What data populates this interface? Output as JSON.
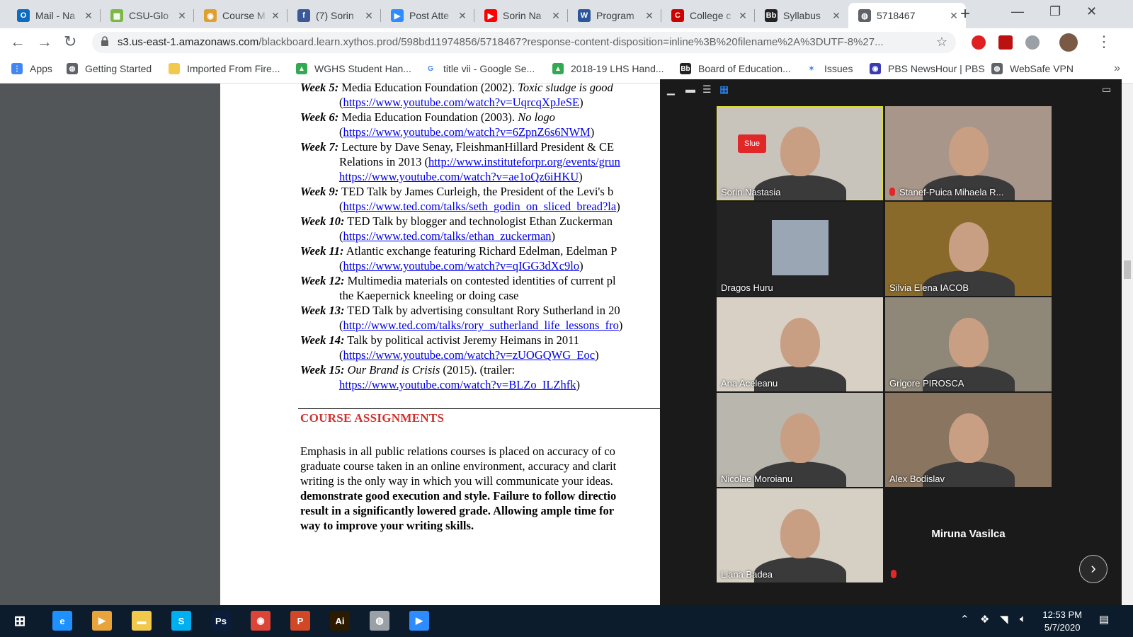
{
  "tabs": [
    {
      "title": "Mail - Na",
      "color": "#0f6cbd",
      "glyph": "O"
    },
    {
      "title": "CSU-Glo",
      "color": "#7db847",
      "glyph": "▦"
    },
    {
      "title": "Course M",
      "color": "#e0a030",
      "glyph": "◉"
    },
    {
      "title": "(7) Sorin",
      "color": "#3b5998",
      "glyph": "f"
    },
    {
      "title": "Post Atte",
      "color": "#2d8cff",
      "glyph": "▶"
    },
    {
      "title": "Sorin Na",
      "color": "#ff0000",
      "glyph": "▶"
    },
    {
      "title": "Program",
      "color": "#2b579a",
      "glyph": "W"
    },
    {
      "title": "College c",
      "color": "#cc0000",
      "glyph": "C"
    },
    {
      "title": "Syllabus",
      "color": "#222222",
      "glyph": "Bb"
    },
    {
      "title": "5718467",
      "color": "#5f6368",
      "glyph": "◍"
    }
  ],
  "toolbar": {
    "url_host": "s3.us-east-1.amazonaws.com",
    "url_path": "/blackboard.learn.xythos.prod/598bd11974856/5718467?response-content-disposition=inline%3B%20filename%2A%3DUTF-8%27..."
  },
  "bookmarks": [
    {
      "label": "Apps",
      "color": "#4285f4",
      "glyph": "⋮"
    },
    {
      "label": "Getting Started",
      "color": "#5f6368",
      "glyph": "◍"
    },
    {
      "label": "Imported From Fire...",
      "color": "#f2c94c",
      "glyph": ""
    },
    {
      "label": "WGHS Student Han...",
      "color": "#34a853",
      "glyph": "▲"
    },
    {
      "label": "title vii - Google Se...",
      "color": "#ffffff",
      "glyph": "G"
    },
    {
      "label": "2018-19 LHS Hand...",
      "color": "#34a853",
      "glyph": "▲"
    },
    {
      "label": "Board of Education...",
      "color": "#222222",
      "glyph": "Bb"
    },
    {
      "label": "Issues",
      "color": "#ffffff",
      "glyph": "✶"
    },
    {
      "label": "PBS NewsHour | PBS",
      "color": "#3a3ab5",
      "glyph": "◉"
    },
    {
      "label": "WebSafe VPN",
      "color": "#5f6368",
      "glyph": "◍"
    }
  ],
  "document": {
    "weeks": [
      {
        "label": "Week 5:",
        "text": " Media Education Foundation (2002). ",
        "italic": "Toxic sludge is good",
        "link": "https://www.youtube.com/watch?v=UqrcqXpJeSE"
      },
      {
        "label": "Week 6:",
        "text": " Media Education Foundation (2003). ",
        "italic": "No logo",
        "link": "https://www.youtube.com/watch?v=6ZpnZ6s6NWM"
      },
      {
        "label": "Week 7:",
        "text": " Lecture by Dave Senay, FleishmanHillard President & CE",
        "line2": "Relations in 2013 (",
        "link2": "http://www.instituteforpr.org/events/grun",
        "link": "https://www.youtube.com/watch?v=ae1oQz6iHKU"
      },
      {
        "label": "Week 9:",
        "text": " TED Talk by James Curleigh, the President of the Levi's b",
        "link": "https://www.ted.com/talks/seth_godin_on_sliced_bread?la"
      },
      {
        "label": "Week 10:",
        "text": " TED Talk by blogger and technologist Ethan Zuckerman",
        "link": "https://www.ted.com/talks/ethan_zuckerman"
      },
      {
        "label": "Week 11:",
        "text": " Atlantic exchange featuring Richard Edelman, Edelman P",
        "link": "https://www.youtube.com/watch?v=qIGG3dXc9lo"
      },
      {
        "label": "Week 12:",
        "text": " Multimedia materials on contested identities of current pl",
        "line2plain": "the Kaepernick kneeling or doing case"
      },
      {
        "label": "Week 13:",
        "text": " TED Talk by advertising consultant Rory Sutherland in 20",
        "link": "http://www.ted.com/talks/rory_sutherland_life_lessons_fro"
      },
      {
        "label": "Week 14:",
        "text": " Talk by political activist Jeremy Heimans in 2011",
        "link": "https://www.youtube.com/watch?v=zUOGQWG_Eoc"
      },
      {
        "label": "Week 15:",
        "text": " ",
        "italic": "Our Brand is Crisis",
        "text2": " (2015). (trailer:",
        "link": "https://www.youtube.com/watch?v=BLZo_ILZhfk",
        "nolparen": true
      }
    ],
    "section_title": "COURSE ASSIGNMENTS",
    "paragraph": [
      "Emphasis in all public relations courses is placed on accuracy of co",
      "graduate course taken in an online environment, accuracy and clarit",
      "writing is the only way in which you will communicate your ideas."
    ],
    "paragraph_bold": [
      "demonstrate good execution and style. Failure to follow directio",
      "result in a significantly lowered grade. Allowing ample time for",
      "way to improve your writing skills."
    ]
  },
  "zoom": {
    "participants": [
      {
        "name": "Sorin Nastasia",
        "active": true,
        "muted": false,
        "bg": "#c9c4bb"
      },
      {
        "name": "Stanef-Puica Mihaela R...",
        "active": false,
        "muted": true,
        "bg": "#a8968a"
      },
      {
        "name": "Dragos Huru",
        "active": false,
        "muted": false,
        "bg": "#232323"
      },
      {
        "name": "Silvia Elena IACOB",
        "active": false,
        "muted": false,
        "bg": "#8a6a2a"
      },
      {
        "name": "Ana Aceleanu",
        "active": false,
        "muted": false,
        "bg": "#d8d0c4"
      },
      {
        "name": "Grigore PIROSCA",
        "active": false,
        "muted": false,
        "bg": "#8f8778"
      },
      {
        "name": "Nicolae Moroianu",
        "active": false,
        "muted": false,
        "bg": "#b9b6ae"
      },
      {
        "name": "Alex Bodislav",
        "active": false,
        "muted": false,
        "bg": "#8a7560"
      },
      {
        "name": "Liana Badea",
        "active": false,
        "muted": false,
        "bg": "#d6cfc4"
      },
      {
        "name": "Miruna Vasilca",
        "active": false,
        "muted": true,
        "bg": "#232323",
        "video_off": true
      }
    ],
    "slide_label": "Slue"
  },
  "taskbar": {
    "apps": [
      {
        "name": "internet-explorer",
        "glyph": "e",
        "color": "#1e90ff"
      },
      {
        "name": "media-player",
        "glyph": "▶",
        "color": "#e8a33a"
      },
      {
        "name": "file-explorer",
        "glyph": "▬",
        "color": "#f2c94c"
      },
      {
        "name": "skype",
        "glyph": "S",
        "color": "#00aff0"
      },
      {
        "name": "photoshop",
        "glyph": "Ps",
        "color": "#0b1d3a"
      },
      {
        "name": "chrome",
        "glyph": "◉",
        "color": "#db4437"
      },
      {
        "name": "powerpoint",
        "glyph": "P",
        "color": "#d24726"
      },
      {
        "name": "illustrator",
        "glyph": "Ai",
        "color": "#2b1a00"
      },
      {
        "name": "app-generic",
        "glyph": "◍",
        "color": "#9aa0a6"
      },
      {
        "name": "zoom",
        "glyph": "▶",
        "color": "#2d8cff"
      }
    ],
    "time": "12:53 PM",
    "date": "5/7/2020"
  }
}
